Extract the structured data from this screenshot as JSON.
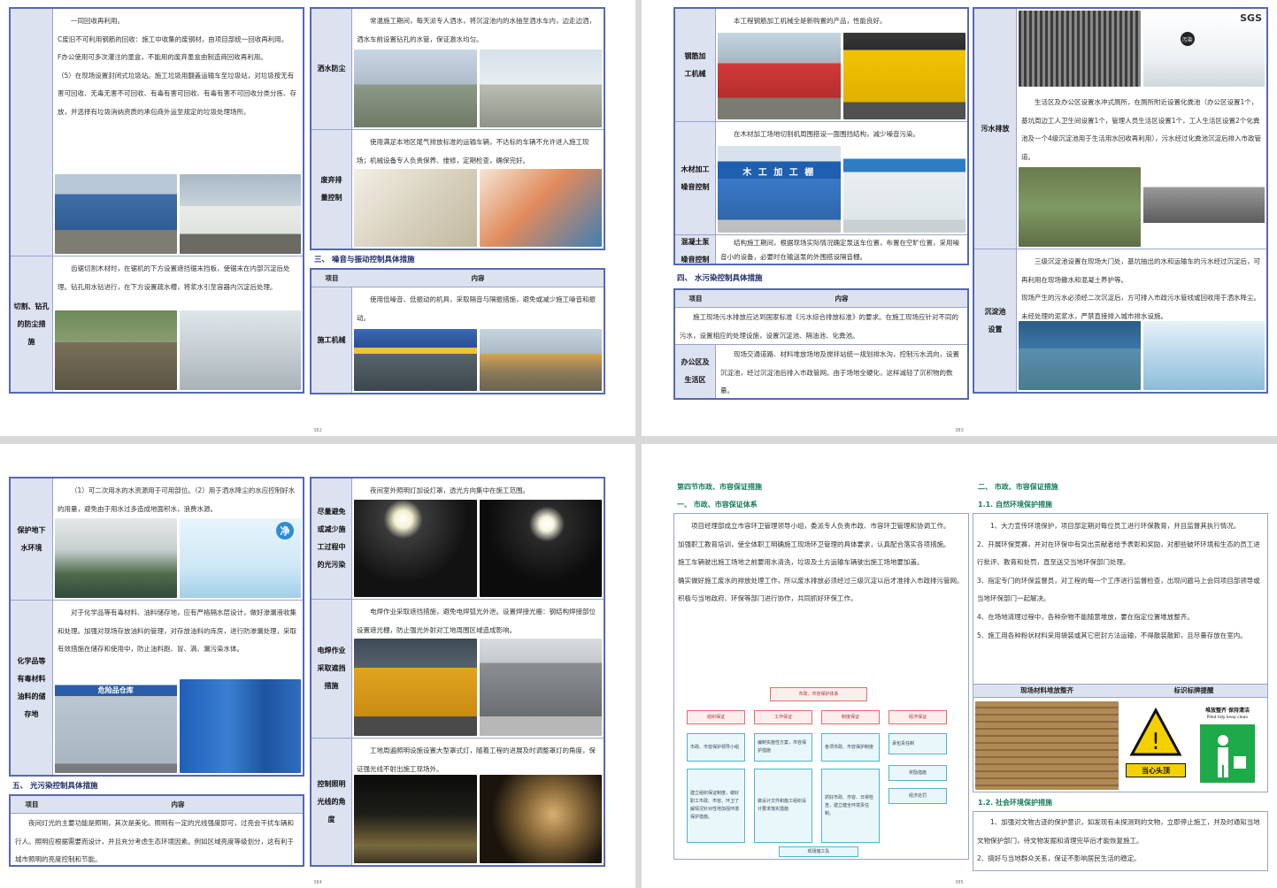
{
  "pages": {
    "p1": {
      "number": "382",
      "left_rows": [
        {
          "label": "",
          "text": "一同回收再利用。\nC废旧不可利用钢筋的回收：施工中收集的废钢材，由项目部统一回收再利用。\nF办公使用可多次灌注的墨盒，不能用的废弃墨盒由制造商回收再利用。\n（5）在现场设置封闭式垃圾站。施工垃圾用翻盖运输车至垃圾站，对垃圾按无有害可回收、无毒无害不可回收、有毒有害可回收、有毒有害不可回收分类分拣、存放，并选择有垃圾消纳资质的承包商外运至规定的垃圾处理场所。"
        },
        {
          "label": "切割、钻孔\n的防尘措\n施",
          "text": "齿锯切割木材时，在锯机的下方设置遮挡锯末挡板，使锯末在内部沉淀后处理。钻孔用水钻进行，在下方设置疏水槽，将浆水引至容器内沉淀后处理。"
        }
      ],
      "right_rows": [
        {
          "label": "洒水防尘",
          "text": "常温施工期间，每天派专人洒水，将沉淀池内的水抽至洒水车内，边走边洒，洒水车前设置钻孔的水管，保证激水均匀。"
        },
        {
          "label": "废弃排\n量控制",
          "text": "使用满足本地区尾气排放标准的运输车辆，不达标的车辆不允许进入施工现场；机械设备专人负责保养、维修，定期检查，确保完好。"
        }
      ],
      "section3_title": "三、 噪音与振动控制具体措施",
      "table_header": {
        "col1": "项目",
        "col2": "内容"
      },
      "noise_row": {
        "label": "施工机械",
        "text": "使用低噪音、低振动的机具，采取隔音与隔振措施，避免或减少施工噪音和振动。"
      }
    },
    "p2": {
      "number": "383",
      "left_rows": [
        {
          "label": "钢筋加\n工机械",
          "text": "本工程钢筋加工机械全是新购置的产品，性能良好。"
        },
        {
          "label": "木材加工\n噪音控制",
          "text": "在木材加工场地切割机周围搭设一面围挡结构，减少噪音污染。"
        },
        {
          "label": "混凝土泵\n噪音控制",
          "text": "结构施工期间，根据现场实际情况确定泵送车位置，布置在空旷位置，采用噪音小的设备，必要时在输送泵的外围搭设隔音棚。"
        }
      ],
      "sign_text": "木 工 加 工 棚",
      "section4_title": "四、 水污染控制具体措施",
      "table_header": {
        "col1": "项目",
        "col2": "内容"
      },
      "office_row": {
        "label": "办公区及\n生活区",
        "text1": "施工现场污水排放应达到国家标准《污水综合排放标准》的要求。在施工现场应针对不同的污水，设置相应的处理设施，设置沉淀池、隔油池、化粪池。",
        "text2": "现场交通道路、材料堆放场地及搅拌站统一规划排水沟，控制污水流向，设置沉淀池，经过沉淀池后排入市政管网。由于场地全硬化，这样减轻了沉积物的数量。"
      },
      "right_rows": [
        {
          "label": "污水排放",
          "text": "生活区及办公区设置水冲式厕所，在厕所附近设置化粪池（办公区设置1个，基坑周边工人卫生间设置1个，管理人员生活区设置1个，工人生活区设置2个化粪池及一个4级沉淀池用于生活用水回收再利用），污水经过化粪池沉淀后排入市政管道。"
        },
        {
          "label": "沉淀池\n设置",
          "text": "三级沉淀池设置在现场大门处，基坑抽出的水和运输车的污水经过沉淀后，可再利用在现场撒水和混凝土养护等。\n现场产生的污水必须经二次沉淀后，方可排入市政污水管线或回收用于洒水降尘。未经处理的泥浆水，严禁直接排入城市排水设施。"
        }
      ],
      "logo_text": "SGS",
      "pollution_text": "污染"
    },
    "p3": {
      "number": "384",
      "left_rows": [
        {
          "label": "保护地下\n水环境",
          "text": "（1）可二次用水的水资源用于可用部位。（2）用于洒水降尘的水应控制好水的用量，避免由于用水过多造成地面积水，浪费水源。"
        },
        {
          "label": "化学品等\n有毒材料\n油料的储\n存地",
          "text": "对于化学品等有毒材料、油料储存地，应有严格隔水层设计，做好渗漏液收集和处理。加强对现场存放油料的管理，对存放油料的库房，进行防渗漏处理，采取有效措施在储存和使用中，防止油料跑、冒、滴、漏污染水体。"
        }
      ],
      "water_sign": "净",
      "warehouse_sign": "危险品仓库",
      "section5_title": "五、 光污染控制具体措施",
      "table_header": {
        "col1": "项目",
        "col2": "内容"
      },
      "light_text": "夜间灯光的主要功能是照明，其次是美化。照明有一定的光线强度即可，过亮会干扰车辆和行人。照明应根据需要而设计，并且充分考虑生态环境因素。例如区域亮度等级划分，这有利于城市照明的亮度控制和节能。",
      "right_rows": [
        {
          "label": "尽量避免\n或减少施\n工过程中\n的光污染",
          "text": "夜间室外照明灯加设灯罩，透光方向集中在施工范围。"
        },
        {
          "label": "电焊作业\n采取遮挡\n措施",
          "text": "电焊作业采取遮挡措施，避免电焊弧光外泄。设置焊接光栅：钢结构焊接部位设置遮光棚，防止强光外射对工地周围区域造成影响。"
        },
        {
          "label": "控制照明\n光线的角\n度",
          "text": "工地周遍照明设施设置大型罩式灯，随着工程的进展及时调整罩灯的角度，保证强光线不射出施工现场外。"
        }
      ]
    },
    "p4": {
      "number": "385",
      "section_title": "第四节市政、市容保证措施",
      "sub1": "一、 市政、市容保证体系",
      "body": "项目经理部成立市容环卫管理领导小组，委派专人负责市政、市容环卫管理和协调工作。\n加强职工教育培训，使全体职工明确施工现场环卫管理的具体要求，认真配合落实各项措施。\n施工车辆驶出施工场地之前要用水清洗，垃圾及土方运输车辆驶出施工场地要加盖。\n确实做好施工废水的排放处理工作，所以废水排放必须经过三级沉淀以后才准排入市政排污管网。\n积极与当地政府、环保等部门进行协作，共同抓好环保工作。",
      "org": {
        "top": "市政、市容保护体系",
        "mid": [
          "组织保证",
          "工作保证",
          "制度保证",
          "经济保证"
        ],
        "low": [
          "市政、市容保护领导小组",
          "编制实施性方案，市容保护措施",
          "各项市政、市容保护制度",
          "承包责任制"
        ],
        "cols": [
          "建立组织保证制度，做好职工市政、市容、环卫了解情况针对性地加强环境保护措施。",
          "做设计文件和施工组织设计要求落实措施",
          "抓好市政、市容、日常检查，建立健全环境责任制。"
        ],
        "side": [
          "奖励措施",
          "经济处罚"
        ],
        "bottom": "现场施工队"
      },
      "right_title": "二、 市政、市容保证措施",
      "r_sub1": "1.1. 自然环境保护措施",
      "r_body1": "1、大力宣传环境保护，项目部定期对每位员工进行环保教育，并且监督其执行情况。\n2、开展环保竞赛，并对在环保中有突出贡献者给予表彰和奖励，对那些破坏环境和生态的员工进行批评、教育和处罚，直至送交当地环保部门处理。\n3、指定专门的环保监督员，对工程的每一个工序进行监督检查，出现问题马上会同项目部领导或当地环保部门一起解决。\n4、在场地清理过程中，各种杂物不能随意堆放，要在指定位置堆放整齐。\n5、施工用各种粉状材料采用袋装或其它密封方法运输，不得散装散卸，且尽量存放在室内。",
      "th_left": "现场材料堆放整齐",
      "th_right": "标识标牌提醒",
      "sign_caution": "当心头顶",
      "sign_tidy": "堆放整齐  保持清洁",
      "sign_tidy_en": "Piled tidy  keep clean",
      "r_sub2": "1.2. 社会环境保护措施",
      "r_body2": "1、加强对文物古迹的保护意识，如发现有未探测到的文物，立即停止施工，并及时通知当地文物保护部门，待文物发掘和清理完毕后才能恢复施工。\n2、搞好与当地群众关系，保证不影响居民生活的稳定。"
    }
  },
  "colors": {
    "border": "#5668b4",
    "label_bg": "#dce2f0",
    "section": "#1f2d6b",
    "green_head": "#1a7c5c"
  }
}
